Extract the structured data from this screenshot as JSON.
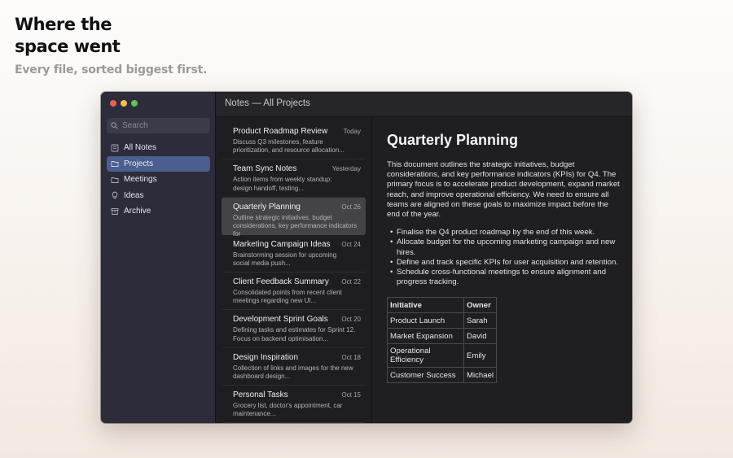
{
  "hero": {
    "title_line1": "Where the",
    "title_line2": "space went",
    "subtitle": "Every file, sorted biggest first."
  },
  "window": {
    "title": "Notes — All Projects"
  },
  "sidebar": {
    "search_placeholder": "Search",
    "items": [
      {
        "label": "All Notes",
        "icon": "all-notes-icon"
      },
      {
        "label": "Projects",
        "icon": "folder-icon"
      },
      {
        "label": "Meetings",
        "icon": "folder-icon"
      },
      {
        "label": "Ideas",
        "icon": "lightbulb-icon"
      },
      {
        "label": "Archive",
        "icon": "archive-icon"
      }
    ],
    "active_index": 1,
    "accent_color": "#4a5f8e"
  },
  "notes": [
    {
      "title": "Product Roadmap Review",
      "date": "Today",
      "preview1": "Discuss Q3 milestones, feature",
      "preview2": "prioritization, and resource allocation..."
    },
    {
      "title": "Team Sync Notes",
      "date": "Yesterday",
      "preview1": "Action items from weekly standup:",
      "preview2": "design handoff, testing..."
    },
    {
      "title": "Quarterly Planning",
      "date": "Oct 26",
      "preview1": "Outline strategic initiatives, budget",
      "preview2": "considerations, key performance indicators for"
    },
    {
      "title": "Marketing Campaign Ideas",
      "date": "Oct 24",
      "preview1": "Brainstorming session for upcoming",
      "preview2": "social media push..."
    },
    {
      "title": "Client Feedback Summary",
      "date": "Oct 22",
      "preview1": "Consolidated points from recent client",
      "preview2": "meetings regarding new UI..."
    },
    {
      "title": "Development Sprint Goals",
      "date": "Oct 20",
      "preview1": "Defining tasks and estimates for Sprint 12.",
      "preview2": "Focus on backend optimisation..."
    },
    {
      "title": "Design Inspiration",
      "date": "Oct 18",
      "preview1": "Collection of links and images for the new",
      "preview2": "dashboard design..."
    },
    {
      "title": "Personal Tasks",
      "date": "Oct 15",
      "preview1": "Grocery list, doctor's appointment, car",
      "preview2": "maintenance..."
    }
  ],
  "document": {
    "title": "Quarterly Planning",
    "body": "This document outlines the strategic initiatives, budget considerations, and key performance indicators (KPIs) for Q4. The primary focus is to accelerate product development, expand market reach, and improve operational efficiency. We need to ensure all teams are aligned on these goals to maximize impact before the end of the year.",
    "bullets": [
      "Finalise the Q4 product roadmap by the end of this week.",
      "Allocate budget for the upcoming marketing campaign and new hires.",
      "Define and track specific KPIs for user acquisition and retention.",
      "Schedule cross-functional meetings to ensure alignment and progress tracking."
    ],
    "table": {
      "headers": [
        "Initiative",
        "Owner"
      ],
      "rows": [
        [
          "Product Launch",
          "Sarah"
        ],
        [
          "Market Expansion",
          "David"
        ],
        [
          "Operational Efficiency",
          "Emily"
        ],
        [
          "Customer Success",
          "Michael"
        ]
      ]
    }
  }
}
